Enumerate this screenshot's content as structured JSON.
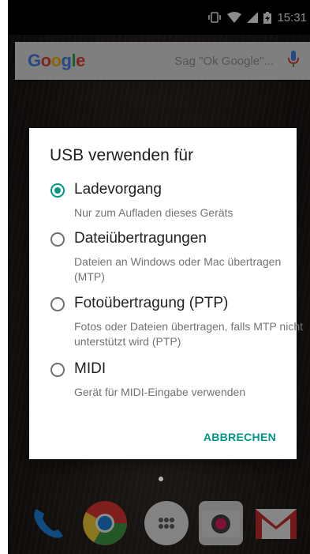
{
  "status_bar": {
    "time": "15:31",
    "icons": [
      "vibrate-icon",
      "wifi-icon",
      "signal-icon",
      "battery-charging-icon"
    ]
  },
  "search_widget": {
    "logo": "Google",
    "hint": "Sag \"Ok Google\"...",
    "mic_icon": "microphone-icon"
  },
  "dock": {
    "apps": [
      "phone-icon",
      "chrome-icon",
      "app-drawer-icon",
      "camera-icon",
      "gmail-icon"
    ]
  },
  "dialog": {
    "title": "USB verwenden für",
    "options": [
      {
        "label": "Ladevorgang",
        "description": "Nur zum Aufladen dieses Geräts",
        "selected": true
      },
      {
        "label": "Dateiübertragungen",
        "description": "Dateien an Windows oder Mac übertragen (MTP)",
        "selected": false
      },
      {
        "label": "Fotoübertragung (PTP)",
        "description": "Fotos oder Dateien übertragen, falls MTP nicht unterstützt wird (PTP)",
        "selected": false
      },
      {
        "label": "MIDI",
        "description": "Gerät für MIDI-Eingabe verwenden",
        "selected": false
      }
    ],
    "cancel_label": "ABBRECHEN"
  },
  "colors": {
    "accent": "#009688",
    "dialog_background": "#ffffff"
  }
}
